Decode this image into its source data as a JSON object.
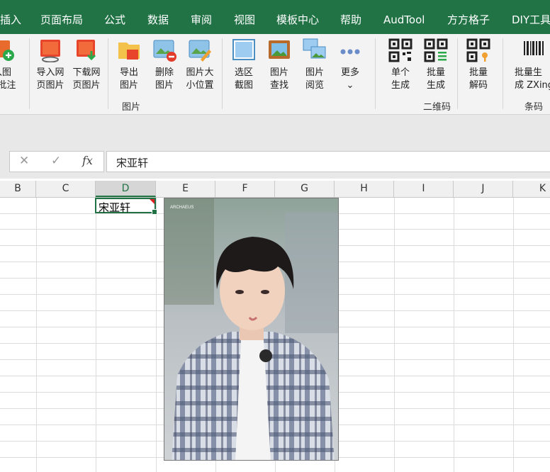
{
  "menu": [
    "插入",
    "页面布局",
    "公式",
    "数据",
    "审阅",
    "视图",
    "模板中心",
    "帮助",
    "AudTool",
    "方方格子",
    "DIY工具"
  ],
  "ribbon": {
    "insert_comment": [
      "入图",
      "到批注"
    ],
    "import_web": [
      "导入网",
      "页图片"
    ],
    "download_web": [
      "下载网",
      "页图片"
    ],
    "export_img": [
      "导出",
      "图片"
    ],
    "delete_img": [
      "删除",
      "图片"
    ],
    "img_size": [
      "图片大",
      "小位置"
    ],
    "select_capture": [
      "选区",
      "截图"
    ],
    "find_img": [
      "图片",
      "查找"
    ],
    "browse_img": [
      "图片",
      "阅览"
    ],
    "more": [
      "更多",
      "⌄"
    ],
    "single_gen": [
      "单个",
      "生成"
    ],
    "batch_gen": [
      "批量",
      "生成"
    ],
    "batch_decode": [
      "批量",
      "解码"
    ],
    "batch_barcode": [
      "批量生",
      "成 ZXing"
    ],
    "group_picture": "图片",
    "group_qrcode": "二维码",
    "group_barcode": "条码和"
  },
  "formula_bar": {
    "cancel": "✕",
    "enter": "✓",
    "fx": "fx",
    "value": "宋亚轩"
  },
  "columns": [
    "B",
    "C",
    "D",
    "E",
    "F",
    "G",
    "H",
    "I",
    "J",
    "K"
  ],
  "selected_cell": {
    "column": "D",
    "value": "宋亚轩"
  },
  "photo": {
    "watermark": "ARCHAEUS",
    "accent": "#217346"
  },
  "colors": {
    "excel_green": "#217346",
    "ribbon_bg": "#f3f3f3",
    "band_bg": "#e8e8e8"
  }
}
